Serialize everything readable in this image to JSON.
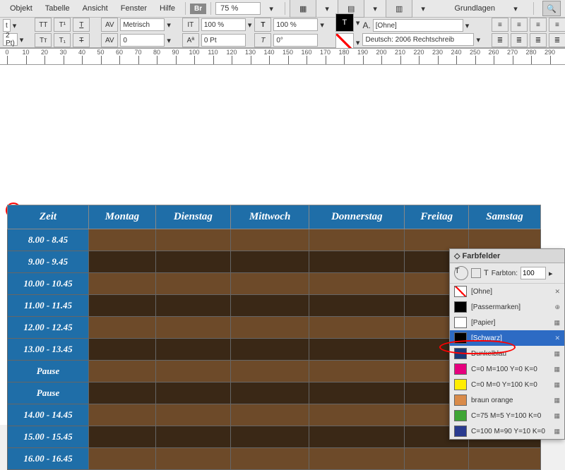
{
  "menu": {
    "objekt": "Objekt",
    "tabelle": "Tabelle",
    "ansicht": "Ansicht",
    "fenster": "Fenster",
    "hilfe": "Hilfe",
    "br": "Br",
    "zoom": "75 %",
    "workspace": "Grundlagen"
  },
  "toolbar": {
    "metric": "Metrisch",
    "scale1": "100 %",
    "scale2": "100 %",
    "rotate": "0°",
    "charstyle": "[Ohne]",
    "lang": "Deutsch: 2006 Rechtschreib"
  },
  "ruler": {
    "start": 0,
    "end": 290,
    "step": 10
  },
  "table": {
    "headers": [
      "Zeit",
      "Montag",
      "Dienstag",
      "Mittwoch",
      "Donnerstag",
      "Freitag",
      "Samstag"
    ],
    "rows": [
      "8.00 - 8.45",
      "9.00 - 9.45",
      "10.00 - 10.45",
      "11.00 - 11.45",
      "12.00 - 12.45",
      "13.00 - 13.45",
      "Pause",
      "Pause",
      "14.00 - 14.45",
      "15.00 - 15.45",
      "16.00 - 16.45"
    ]
  },
  "panel": {
    "title": "Farbfelder",
    "tone_label": "Farbton:",
    "tone_value": "100",
    "items": [
      {
        "name": "[Ohne]",
        "color": "#fff",
        "none": true,
        "lock": true
      },
      {
        "name": "[Passermarken]",
        "color": "#000",
        "reg": true
      },
      {
        "name": "[Papier]",
        "color": "#fff"
      },
      {
        "name": "[Schwarz]",
        "color": "#000",
        "sel": true,
        "lock": true
      },
      {
        "name": "Dunkelblau",
        "color": "#1a3a7a",
        "mark": true
      },
      {
        "name": "C=0 M=100 Y=0 K=0",
        "color": "#e6007e"
      },
      {
        "name": "C=0 M=0 Y=100 K=0",
        "color": "#ffed00"
      },
      {
        "name": "braun orange",
        "color": "#d98b4a"
      },
      {
        "name": "C=75 M=5 Y=100 K=0",
        "color": "#3fa535"
      },
      {
        "name": "C=100 M=90 Y=10 K=0",
        "color": "#2a3b8f"
      }
    ]
  }
}
